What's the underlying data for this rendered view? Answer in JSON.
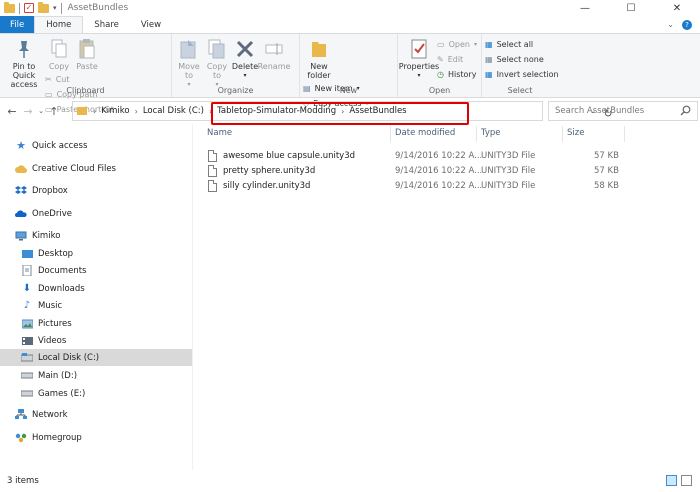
{
  "window": {
    "title": "AssetBundles",
    "qat_dropdown": "▾",
    "controls": {
      "minimize": "—",
      "maximize": "☐",
      "close": "✕"
    }
  },
  "tabs": [
    {
      "label": "File"
    },
    {
      "label": "Home"
    },
    {
      "label": "Share"
    },
    {
      "label": "View"
    }
  ],
  "ribbon": {
    "clipboard": {
      "label": "Clipboard",
      "pin": "Pin to Quick access",
      "copy": "Copy",
      "paste": "Paste",
      "cut": "Cut",
      "copy_path": "Copy path",
      "paste_shortcut": "Paste shortcut"
    },
    "organize": {
      "label": "Organize",
      "move_to": "Move to",
      "copy_to": "Copy to",
      "delete": "Delete",
      "rename": "Rename"
    },
    "new": {
      "label": "New",
      "new_folder": "New folder",
      "new_item": "New item",
      "easy_access": "Easy access"
    },
    "open": {
      "label": "Open",
      "properties": "Properties",
      "open": "Open",
      "edit": "Edit",
      "history": "History"
    },
    "select": {
      "label": "Select",
      "select_all": "Select all",
      "select_none": "Select none",
      "invert": "Invert selection"
    }
  },
  "address": {
    "breadcrumbs": [
      "Kimiko",
      "Local Disk (C:)",
      "Tabletop-Simulator-Modding",
      "AssetBundles"
    ],
    "search_placeholder": "Search AssetBundles"
  },
  "nav": {
    "items": [
      {
        "label": "Quick access",
        "icon": "star-icon"
      },
      {
        "label": "Creative Cloud Files",
        "icon": "creative-cloud-icon"
      },
      {
        "label": "Dropbox",
        "icon": "dropbox-icon"
      },
      {
        "label": "OneDrive",
        "icon": "onedrive-icon"
      },
      {
        "label": "Kimiko",
        "icon": "computer-icon"
      },
      {
        "label": "Desktop",
        "icon": "desktop-folder-icon"
      },
      {
        "label": "Documents",
        "icon": "documents-folder-icon"
      },
      {
        "label": "Downloads",
        "icon": "downloads-folder-icon"
      },
      {
        "label": "Music",
        "icon": "music-folder-icon"
      },
      {
        "label": "Pictures",
        "icon": "pictures-folder-icon"
      },
      {
        "label": "Videos",
        "icon": "videos-folder-icon"
      },
      {
        "label": "Local Disk (C:)",
        "icon": "disk-icon"
      },
      {
        "label": "Main (D:)",
        "icon": "drive-icon"
      },
      {
        "label": "Games (E:)",
        "icon": "drive-icon"
      },
      {
        "label": "Network",
        "icon": "network-icon"
      },
      {
        "label": "Homegroup",
        "icon": "homegroup-icon"
      }
    ]
  },
  "columns": {
    "name": "Name",
    "date": "Date modified",
    "type": "Type",
    "size": "Size"
  },
  "files": [
    {
      "name": "awesome blue capsule.unity3d",
      "date": "9/14/2016 10:22 A...",
      "type": "UNITY3D File",
      "size": "57 KB"
    },
    {
      "name": "pretty sphere.unity3d",
      "date": "9/14/2016 10:22 A...",
      "type": "UNITY3D File",
      "size": "57 KB"
    },
    {
      "name": "silly cylinder.unity3d",
      "date": "9/14/2016 10:22 A...",
      "type": "UNITY3D File",
      "size": "58 KB"
    }
  ],
  "status": {
    "count": "3 items"
  },
  "colors": {
    "accent": "#1979ca",
    "highlight": "#e00000",
    "folder": "#e8b84a"
  }
}
